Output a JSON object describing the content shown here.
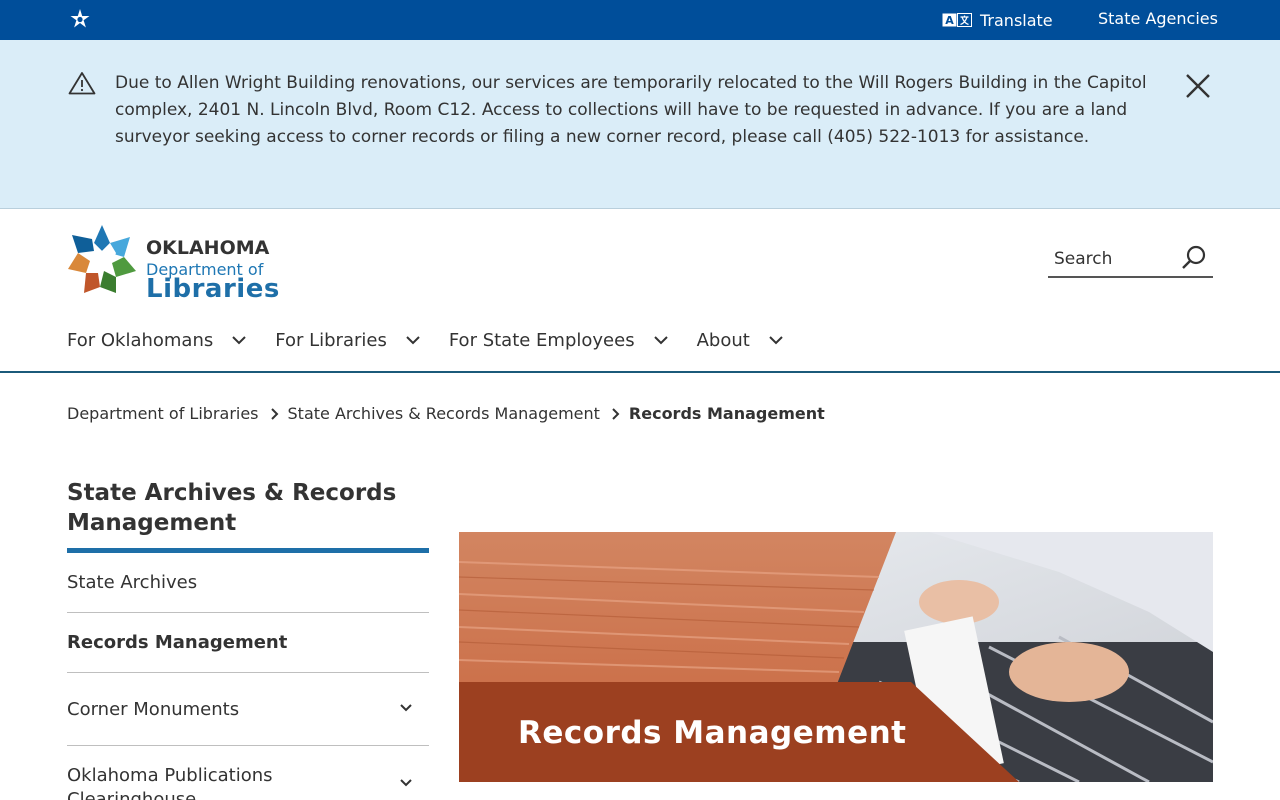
{
  "topbar": {
    "brand_icon": "oklahoma-star-icon",
    "translate_icon": "translate-icon",
    "translate_label": "Translate",
    "agencies_label": "State Agencies"
  },
  "alert": {
    "icon": "warning-icon",
    "message": "Due to Allen Wright Building renovations, our services are temporarily relocated to the Will Rogers Building in the Capitol complex, 2401 N. Lincoln Blvd, Room C12. Access to collections will have to be requested in advance. If you are a land surveyor seeking access to corner records or filing a new corner record, please call (405) 522-1013 for assistance.",
    "close_icon": "close-icon"
  },
  "logo": {
    "line1": "OKLAHOMA",
    "line2": "Department of",
    "line3": "Libraries"
  },
  "search": {
    "placeholder": "Search",
    "icon": "search-icon"
  },
  "nav": {
    "items": [
      {
        "label": "For Oklahomans"
      },
      {
        "label": "For Libraries"
      },
      {
        "label": "For State Employees"
      },
      {
        "label": "About"
      }
    ]
  },
  "breadcrumb": {
    "items": [
      {
        "label": "Department of Libraries"
      },
      {
        "label": "State Archives & Records Management"
      }
    ],
    "current": "Records Management"
  },
  "sidenav": {
    "title": "State Archives & Records Management",
    "items": [
      {
        "label": "State Archives"
      },
      {
        "label": "Records Management"
      },
      {
        "label": "Corner Monuments"
      },
      {
        "label": "Oklahoma Publications Clearinghouse"
      }
    ]
  },
  "banner": {
    "title": "Records Management"
  },
  "colors": {
    "topbar": "#004e9a",
    "alert_bg": "#daedf8",
    "accent": "#1e6fa8",
    "banner_orange": "#d9784e",
    "banner_brown": "#9c4020"
  }
}
